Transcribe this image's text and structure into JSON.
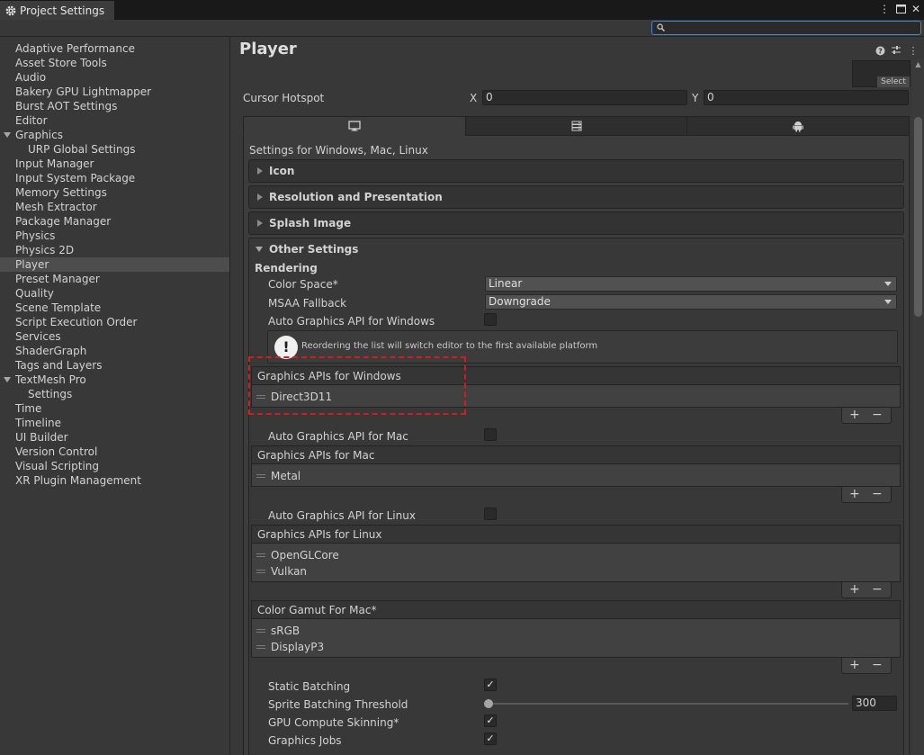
{
  "window": {
    "tab_title": "Project Settings",
    "search_value": ""
  },
  "sidebar": {
    "items": [
      {
        "label": "Adaptive Performance"
      },
      {
        "label": "Asset Store Tools"
      },
      {
        "label": "Audio"
      },
      {
        "label": "Bakery GPU Lightmapper"
      },
      {
        "label": "Burst AOT Settings"
      },
      {
        "label": "Editor"
      },
      {
        "label": "Graphics"
      },
      {
        "label": "URP Global Settings"
      },
      {
        "label": "Input Manager"
      },
      {
        "label": "Input System Package"
      },
      {
        "label": "Memory Settings"
      },
      {
        "label": "Mesh Extractor"
      },
      {
        "label": "Package Manager"
      },
      {
        "label": "Physics"
      },
      {
        "label": "Physics 2D"
      },
      {
        "label": "Player"
      },
      {
        "label": "Preset Manager"
      },
      {
        "label": "Quality"
      },
      {
        "label": "Scene Template"
      },
      {
        "label": "Script Execution Order"
      },
      {
        "label": "Services"
      },
      {
        "label": "ShaderGraph"
      },
      {
        "label": "Tags and Layers"
      },
      {
        "label": "TextMesh Pro"
      },
      {
        "label": "Settings"
      },
      {
        "label": "Time"
      },
      {
        "label": "Timeline"
      },
      {
        "label": "UI Builder"
      },
      {
        "label": "Version Control"
      },
      {
        "label": "Visual Scripting"
      },
      {
        "label": "XR Plugin Management"
      }
    ],
    "selected": "Player"
  },
  "main": {
    "title": "Player",
    "select_label": "Select",
    "cursor_hotspot": {
      "label": "Cursor Hotspot",
      "x_label": "X",
      "x_value": "0",
      "y_label": "Y",
      "y_value": "0"
    },
    "settings_for": "Settings for Windows, Mac, Linux",
    "foldouts": {
      "icon": "Icon",
      "resolution": "Resolution and Presentation",
      "splash": "Splash Image",
      "other": "Other Settings"
    },
    "rendering": {
      "heading": "Rendering",
      "color_space_label": "Color Space*",
      "color_space_value": "Linear",
      "msaa_label": "MSAA Fallback",
      "msaa_value": "Downgrade",
      "auto_windows_label": "Auto Graphics API  for Windows",
      "warning": "Reordering the list will switch editor to the first available platform",
      "windows_list_title": "Graphics APIs for Windows",
      "windows_apis": [
        "Direct3D11"
      ],
      "auto_mac_label": "Auto Graphics API  for Mac",
      "mac_list_title": "Graphics APIs for Mac",
      "mac_apis": [
        "Metal"
      ],
      "auto_linux_label": "Auto Graphics API  for Linux",
      "linux_list_title": "Graphics APIs for Linux",
      "linux_apis": [
        "OpenGLCore",
        "Vulkan"
      ],
      "gamut_title": "Color Gamut For Mac*",
      "gamut_items": [
        "sRGB",
        "DisplayP3"
      ],
      "static_batching_label": "Static Batching",
      "sprite_threshold_label": "Sprite Batching Threshold",
      "sprite_threshold_value": "300",
      "gpu_skinning_label": "GPU Compute Skinning*",
      "graphics_jobs_label": "Graphics Jobs"
    }
  },
  "colors": {
    "highlight_box": "#d21d1d",
    "search_border": "#4a86c8"
  }
}
